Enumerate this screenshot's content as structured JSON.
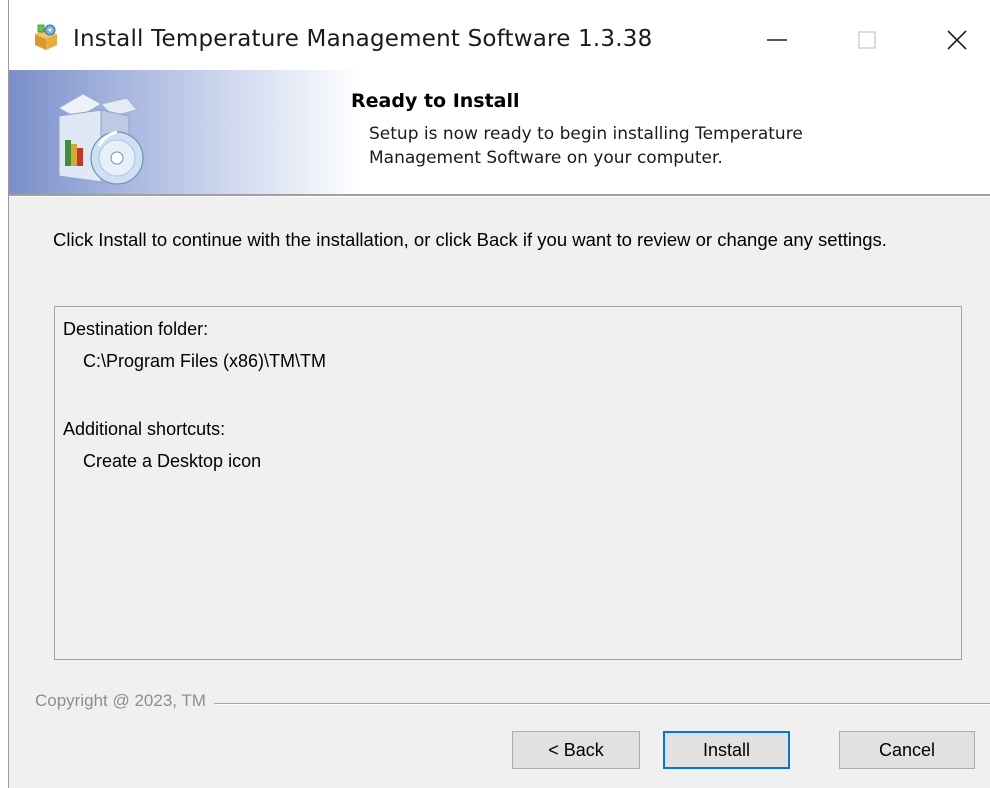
{
  "window": {
    "title": "Install Temperature Management Software 1.3.38"
  },
  "banner": {
    "heading": "Ready to Install",
    "subtitle_line1": "Setup is now ready to begin installing Temperature",
    "subtitle_line2": "Management Software on your computer."
  },
  "body": {
    "intro": "Click Install to continue with the installation, or click Back if you want to review or change any settings.",
    "summary": {
      "destination_label": "Destination folder:",
      "destination_value": "C:\\Program Files (x86)\\TM\\TM",
      "shortcuts_label": "Additional shortcuts:",
      "shortcuts_value": "Create a Desktop icon"
    }
  },
  "footer": {
    "copyright": "Copyright @ 2023, TM",
    "back_label": "< Back",
    "install_label": "Install",
    "cancel_label": "Cancel"
  },
  "icons": {
    "app": "setup-box-icon",
    "banner": "install-box-cd-icon",
    "minimize": "minimize-icon",
    "maximize": "maximize-icon",
    "close": "close-icon"
  },
  "colors": {
    "accent": "#0078d7",
    "dialog_bg": "#f0f0f0",
    "banner_gradient_start": "#7a8fc9"
  }
}
